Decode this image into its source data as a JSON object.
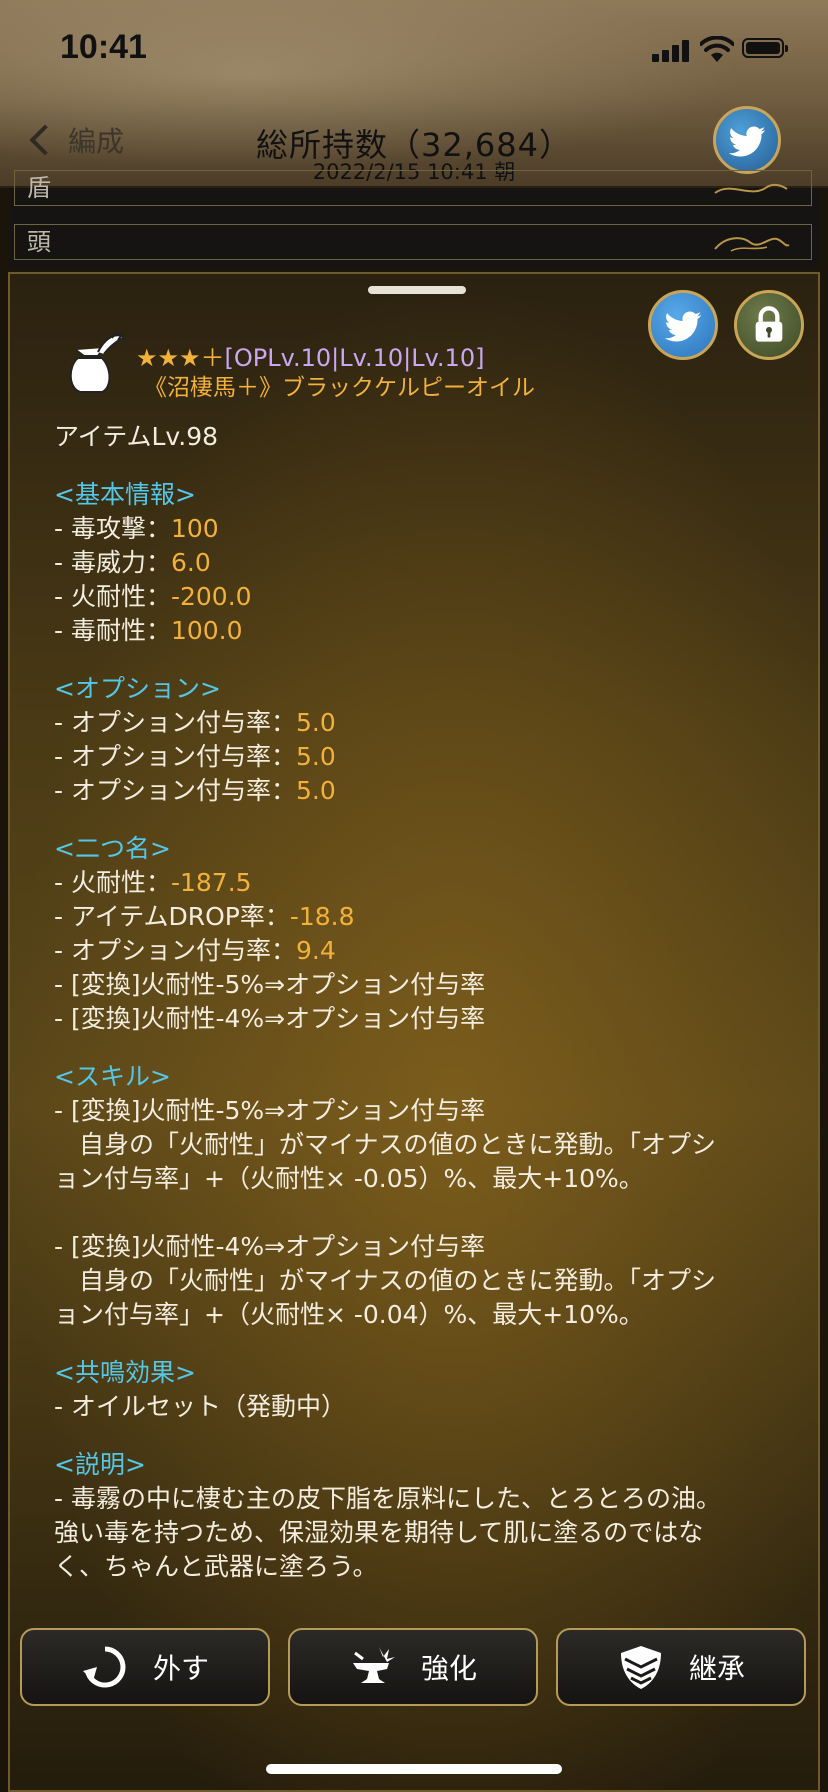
{
  "status": {
    "time": "10:41"
  },
  "header": {
    "back_label": "編成",
    "title": "総所持数（32,684）",
    "date": "2022/2/15  10:41  朝"
  },
  "strip": {
    "rows": [
      "盾",
      "頭"
    ]
  },
  "item": {
    "stars": "★★★＋",
    "levels": "[OPLv.10|Lv.10|Lv.10]",
    "name": "《沼棲馬＋》ブラックケルピーオイル",
    "item_level": "アイテムLv.98"
  },
  "sections": {
    "basic": {
      "title": "<基本情報>",
      "lines": [
        {
          "label": "- 毒攻撃：",
          "value": "100"
        },
        {
          "label": "- 毒威力：",
          "value": "6.0"
        },
        {
          "label": "- 火耐性：",
          "value": "-200.0"
        },
        {
          "label": "- 毒耐性：",
          "value": "100.0"
        }
      ]
    },
    "option": {
      "title": "<オプション>",
      "lines": [
        {
          "label": "- オプション付与率：",
          "value": "5.0"
        },
        {
          "label": "- オプション付与率：",
          "value": "5.0"
        },
        {
          "label": "- オプション付与率：",
          "value": "5.0"
        }
      ]
    },
    "title2": {
      "title": "<二つ名>",
      "lines": [
        {
          "label": "- 火耐性：",
          "value": "-187.5"
        },
        {
          "label": "- アイテムDROP率：",
          "value": "-18.8"
        },
        {
          "label": "- オプション付与率：",
          "value": "9.4"
        },
        {
          "label": "- [変換]火耐性-5%⇒オプション付与率",
          "value": ""
        },
        {
          "label": "- [変換]火耐性-4%⇒オプション付与率",
          "value": ""
        }
      ]
    },
    "skill": {
      "title": "<スキル>",
      "s1_name": "- [変換]火耐性-5%⇒オプション付与率",
      "s1_desc1": "　自身の「火耐性」がマイナスの値のときに発動。「オプシ",
      "s1_desc2": "ョン付与率」+（火耐性× -0.05）%、最大+10%。",
      "s2_name": "- [変換]火耐性-4%⇒オプション付与率",
      "s2_desc1": "　自身の「火耐性」がマイナスの値のときに発動。「オプシ",
      "s2_desc2": "ョン付与率」+（火耐性× -0.04）%、最大+10%。"
    },
    "resonance": {
      "title": "<共鳴効果>",
      "line": "- オイルセット（発動中）"
    },
    "description": {
      "title": "<説明>",
      "line1": "- 毒霧の中に棲む主の皮下脂を原料にした、とろとろの油。",
      "line2": "強い毒を持つため、保湿効果を期待して肌に塗るのではな",
      "line3": "く、ちゃんと武器に塗ろう。"
    }
  },
  "buttons": {
    "remove": "外す",
    "enhance": "強化",
    "inherit": "継承"
  },
  "colors": {
    "section": "#54c6e6",
    "value": "#f2b13a",
    "star": "#f2b13a",
    "twitter": "#4a9be0"
  },
  "icons": [
    "twitter-icon",
    "lock-icon",
    "oil-bag-icon",
    "rotate-icon",
    "anvil-icon",
    "shield-icon"
  ]
}
